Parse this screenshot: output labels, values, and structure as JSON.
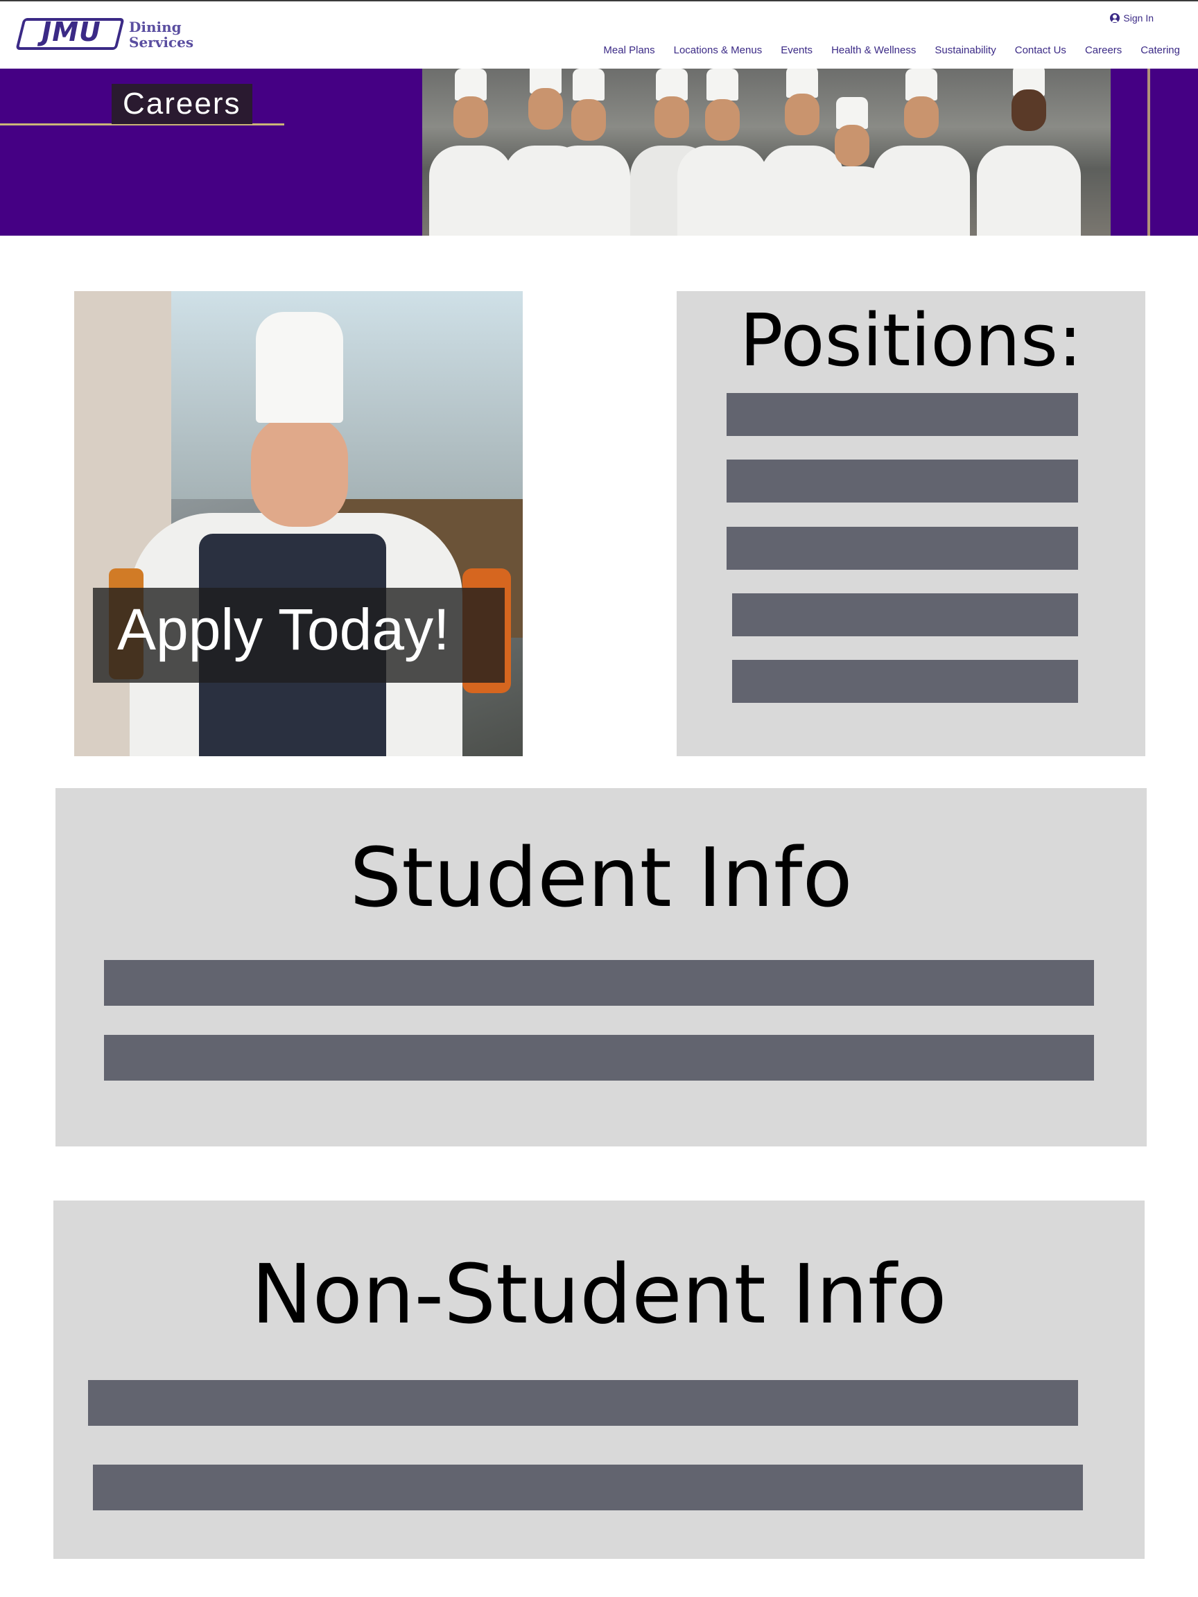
{
  "brand": {
    "logo_text": "JMU",
    "logo_sub_line1": "Dining",
    "logo_sub_line2": "Services",
    "primary_color": "#450084",
    "accent_color": "#cbb677",
    "nav_color": "#3b2a86"
  },
  "header": {
    "sign_in": "Sign In",
    "nav": [
      "Meal Plans",
      "Locations & Menus",
      "Events",
      "Health & Wellness",
      "Sustainability",
      "Contact Us",
      "Careers",
      "Catering"
    ]
  },
  "hero": {
    "title": "Careers"
  },
  "apply": {
    "label": "Apply Today!"
  },
  "positions": {
    "title": "Positions:",
    "item_count": 5
  },
  "student_info": {
    "title": "Student Info",
    "item_count": 2
  },
  "non_student_info": {
    "title": "Non-Student Info",
    "item_count": 2
  }
}
